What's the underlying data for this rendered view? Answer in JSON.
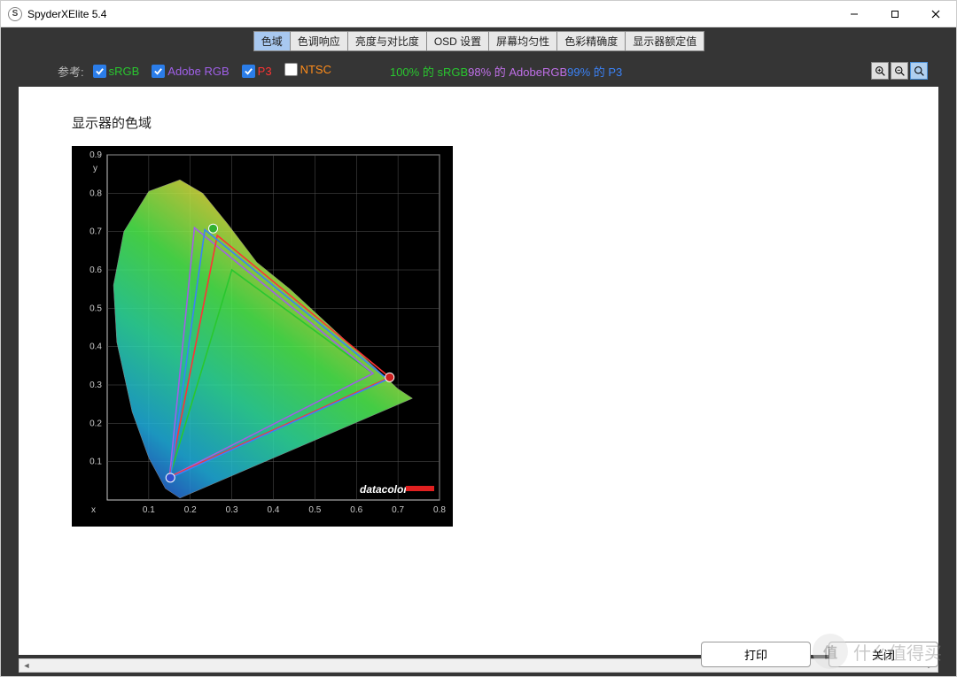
{
  "window": {
    "icon_letter": "S",
    "title": "SpyderXElite 5.4"
  },
  "tabs": [
    {
      "label": "色域",
      "active": true
    },
    {
      "label": "色调响应",
      "active": false
    },
    {
      "label": "亮度与对比度",
      "active": false
    },
    {
      "label": "OSD 设置",
      "active": false
    },
    {
      "label": "屏幕均匀性",
      "active": false
    },
    {
      "label": "色彩精确度",
      "active": false
    },
    {
      "label": "显示器额定值",
      "active": false
    }
  ],
  "reference": {
    "label": "参考:",
    "items": [
      {
        "key": "srgb",
        "label": "sRGB",
        "checked": true,
        "color": "#29c72f"
      },
      {
        "key": "adobergb",
        "label": "Adobe RGB",
        "checked": true,
        "color": "#a060e8"
      },
      {
        "key": "p3",
        "label": "P3",
        "checked": true,
        "color": "#ff3333"
      },
      {
        "key": "ntsc",
        "label": "NTSC",
        "checked": false,
        "color": "#ff8c1a"
      }
    ],
    "results": [
      {
        "key": "srgb",
        "label": "100% 的 sRGB",
        "color": "#29c72f"
      },
      {
        "key": "adobergb",
        "label": "98% 的 AdobeRGB",
        "color": "#c070e8"
      },
      {
        "key": "p3",
        "label": "99% 的 P3",
        "color": "#3b82f6"
      }
    ]
  },
  "content": {
    "title": "显示器的色域",
    "brand": "datacolor"
  },
  "footer": {
    "print": "打印",
    "close": "关闭"
  },
  "watermark": {
    "icon": "值",
    "text": "什么值得买"
  },
  "chart_data": {
    "type": "chromaticity-diagram",
    "title": "显示器的色域",
    "xlabel": "x",
    "ylabel": "y",
    "xlim": [
      0,
      0.8
    ],
    "ylim": [
      0,
      0.9
    ],
    "xticks": [
      0.1,
      0.2,
      0.3,
      0.4,
      0.5,
      0.6,
      0.7,
      0.8
    ],
    "yticks": [
      0.1,
      0.2,
      0.3,
      0.4,
      0.5,
      0.6,
      0.7,
      0.8,
      0.9
    ],
    "spectral_locus": [
      [
        0.175,
        0.005
      ],
      [
        0.14,
        0.03
      ],
      [
        0.1,
        0.11
      ],
      [
        0.06,
        0.23
      ],
      [
        0.023,
        0.412
      ],
      [
        0.015,
        0.56
      ],
      [
        0.04,
        0.7
      ],
      [
        0.1,
        0.805
      ],
      [
        0.175,
        0.835
      ],
      [
        0.23,
        0.8
      ],
      [
        0.29,
        0.72
      ],
      [
        0.36,
        0.62
      ],
      [
        0.44,
        0.55
      ],
      [
        0.53,
        0.46
      ],
      [
        0.62,
        0.37
      ],
      [
        0.7,
        0.29
      ],
      [
        0.735,
        0.265
      ]
    ],
    "series": [
      {
        "name": "sRGB",
        "color": "#29c72f",
        "vertices": [
          [
            0.64,
            0.33
          ],
          [
            0.3,
            0.6
          ],
          [
            0.15,
            0.06
          ]
        ]
      },
      {
        "name": "Adobe RGB",
        "color": "#a060e8",
        "vertices": [
          [
            0.64,
            0.33
          ],
          [
            0.21,
            0.71
          ],
          [
            0.15,
            0.06
          ]
        ]
      },
      {
        "name": "P3",
        "color": "#ff3333",
        "vertices": [
          [
            0.68,
            0.32
          ],
          [
            0.265,
            0.69
          ],
          [
            0.15,
            0.06
          ]
        ]
      },
      {
        "name": "Monitor",
        "color": "#3b82f6",
        "vertices": [
          [
            0.675,
            0.315
          ],
          [
            0.235,
            0.705
          ],
          [
            0.152,
            0.058
          ]
        ]
      }
    ],
    "markers": [
      {
        "name": "red-primary",
        "xy": [
          0.68,
          0.32
        ],
        "color": "#cc2020"
      },
      {
        "name": "green-primary",
        "xy": [
          0.255,
          0.708
        ],
        "color": "#30b030"
      },
      {
        "name": "blue-primary",
        "xy": [
          0.152,
          0.058
        ],
        "color": "#3050d0"
      }
    ]
  }
}
